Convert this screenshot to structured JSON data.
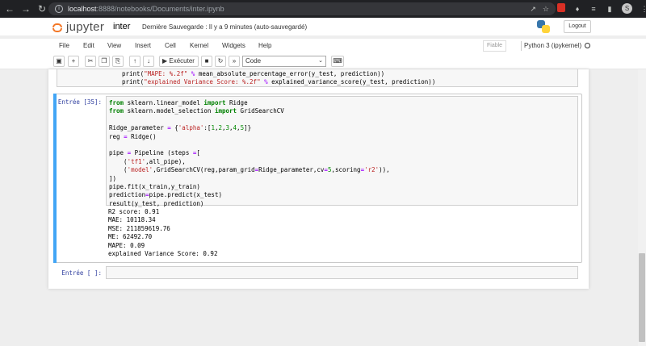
{
  "browser": {
    "url_host": "localhost",
    "url_path": ":8888/notebooks/Documents/inter.ipynb",
    "avatar_letter": "S"
  },
  "header": {
    "logo_text": "jupyter",
    "notebook_name": "inter",
    "save_status": "Dernière Sauvegarde : Il y a 9 minutes  (auto-sauvegardé)",
    "logout_label": "Logout"
  },
  "menu": {
    "items": [
      "File",
      "Edit",
      "View",
      "Insert",
      "Cell",
      "Kernel",
      "Widgets",
      "Help"
    ],
    "trusted_label": "Fiable",
    "kernel_label": "Python 3 (ipykernel)"
  },
  "toolbar": {
    "run_label": "Exécuter",
    "cell_type": "Code"
  },
  "prev_cell": {
    "lines": [
      "print(\"MAPE: %.2f\" % mean_absolute_percentage_error(y_test, prediction))",
      "print(\"explained Variance Score: %.2f\" % explained_variance_score(y_test, prediction))"
    ]
  },
  "cell": {
    "prompt": "Entrée [35]:",
    "code_lines": [
      "from sklearn.linear_model import Ridge",
      "from sklearn.model_selection import GridSearchCV",
      "",
      "Ridge_parameter = {'alpha':[1,2,3,4,5]}",
      "reg = Ridge()",
      "",
      "pipe = Pipeline (steps =[",
      "    ('tf1',all_pipe),",
      "    ('model',GridSearchCV(reg,param_grid=Ridge_parameter,cv=5,scoring='r2')),",
      "])",
      "pipe.fit(x_train,y_train)",
      "prediction=pipe.predict(x_test)",
      "result(y_test, prediction)"
    ],
    "output_lines": [
      "R2 score: 0.91",
      "MAE: 10118.34",
      "MSE: 211859619.76",
      "ME: 62492.70",
      "MAPE: 0.09",
      "explained Variance Score: 0.92"
    ]
  },
  "empty_cell": {
    "prompt": "Entrée [ ]:"
  },
  "colors": {
    "accent_selected": "#42a5f5",
    "jupyter_orange": "#f37726",
    "prompt_blue": "#303f9f"
  }
}
